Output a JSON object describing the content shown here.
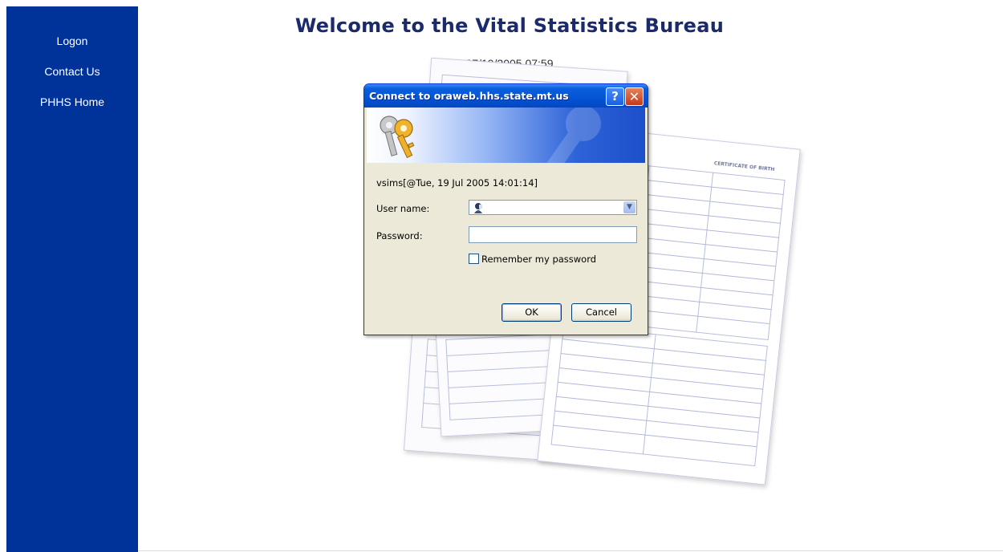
{
  "sidebar": {
    "items": [
      {
        "label": "Logon"
      },
      {
        "label": "Contact Us"
      },
      {
        "label": "PHHS Home"
      }
    ],
    "color": "#003399"
  },
  "header": {
    "title": "Welcome to the Vital Statistics Bureau",
    "datetime": "07/19/2005 07:59"
  },
  "background": {
    "certificate_title": "CERTIFICATE OF BIRTH"
  },
  "dialog": {
    "title": "Connect to oraweb.hhs.state.mt.us",
    "help_label": "?",
    "close_label": "✕",
    "realm": "vsims[@Tue, 19 Jul 2005 14:01:14]",
    "username_label": "User name:",
    "username_value": "",
    "password_label": "Password:",
    "password_value": "",
    "remember_label": "Remember my password",
    "remember_checked": false,
    "ok_label": "OK",
    "cancel_label": "Cancel",
    "icons": {
      "banner": "keys-icon",
      "user": "user-icon",
      "dropdown": "chevron-down-icon"
    },
    "accent": "#0554d3"
  }
}
